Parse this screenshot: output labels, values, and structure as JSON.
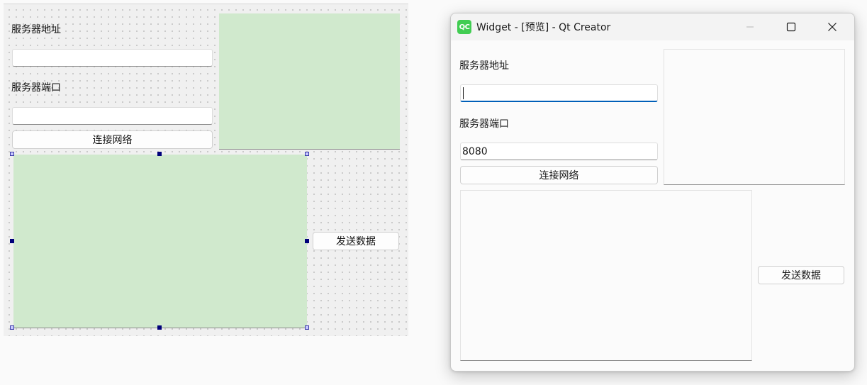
{
  "designer": {
    "server_address_label": "服务器地址",
    "server_port_label": "服务器端口",
    "connect_button": "连接网络",
    "send_button": "发送数据"
  },
  "preview_window": {
    "title": "Widget - [预览] - Qt Creator",
    "app_icon_text": "QC",
    "server_address_label": "服务器地址",
    "server_address_value": "",
    "server_port_label": "服务器端口",
    "server_port_value": "8080",
    "connect_button": "连接网络",
    "send_button": "发送数据"
  },
  "colors": {
    "designer_green": "#d0e9cd",
    "focus_blue": "#005fb8",
    "qt_green": "#41cd52",
    "selection_handle": "#00007a"
  },
  "icons": {
    "window_minimize": "minimize-icon",
    "window_maximize": "maximize-icon",
    "window_close": "close-icon"
  }
}
